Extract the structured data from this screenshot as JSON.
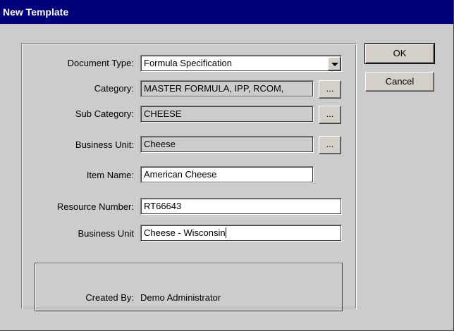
{
  "window": {
    "title": "New Template"
  },
  "form": {
    "document_type": {
      "label": "Document Type:",
      "value": "Formula Specification"
    },
    "category": {
      "label": "Category:",
      "value": "MASTER FORMULA, IPP, RCOM,",
      "browse": "..."
    },
    "sub_category": {
      "label": "Sub Category:",
      "value": "CHEESE",
      "browse": "..."
    },
    "business_unit": {
      "label": "Business Unit:",
      "value": "Cheese",
      "browse": "..."
    },
    "item_name": {
      "label": "Item Name:",
      "value": "American Cheese"
    },
    "resource_number": {
      "label": "Resource Number:",
      "value": "RT66643"
    },
    "business_unit_2": {
      "label": "Business Unit",
      "value": "Cheese - Wisconsin"
    },
    "created_by": {
      "label": "Created By:",
      "value": "Demo Administrator"
    }
  },
  "buttons": {
    "ok": "OK",
    "cancel": "Cancel"
  },
  "icons": {
    "dropdown": "chevron-down-icon"
  }
}
